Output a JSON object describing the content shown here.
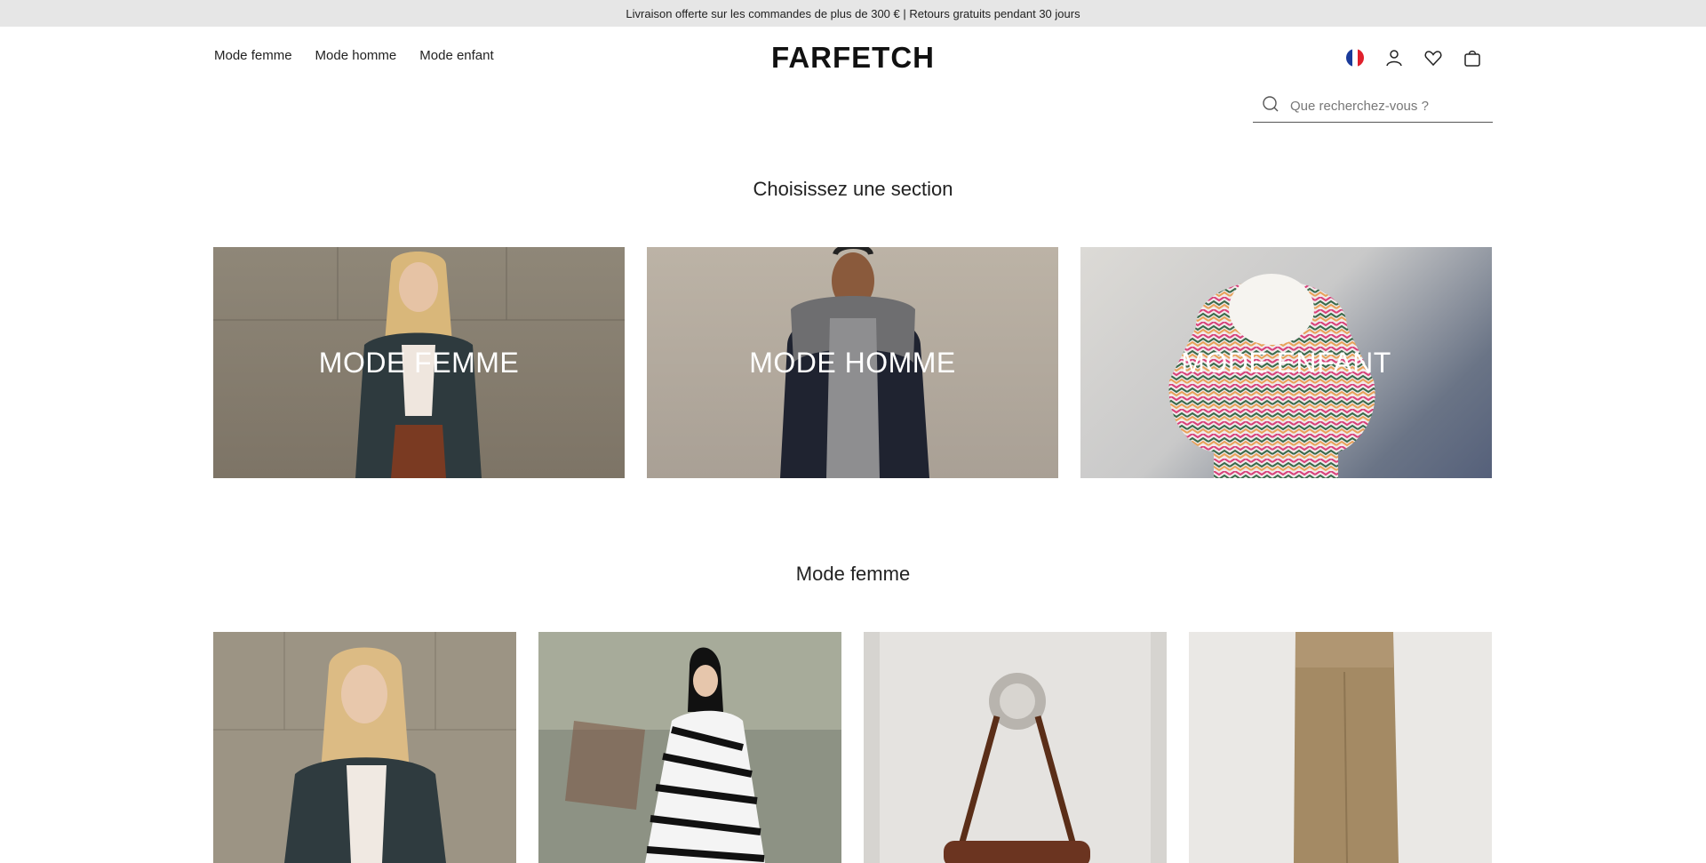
{
  "promo": {
    "text": "Livraison offerte sur les commandes de plus de 300 € | Retours gratuits pendant 30 jours"
  },
  "header": {
    "nav": [
      "Mode femme",
      "Mode homme",
      "Mode enfant"
    ],
    "logo": "FARFETCH",
    "icons": [
      "france-flag-icon",
      "account-icon",
      "wishlist-heart-icon",
      "shopping-bag-icon"
    ],
    "search_placeholder": "Que recherchez-vous ?"
  },
  "sections_title": "Choisissez une section",
  "sections": [
    {
      "label": "MODE FEMME"
    },
    {
      "label": "MODE HOMME"
    },
    {
      "label": "MODE ENFANT"
    }
  ],
  "femme_title": "Mode femme",
  "colors": {
    "promo_bg": "#e6e6e6",
    "text": "#222222"
  }
}
